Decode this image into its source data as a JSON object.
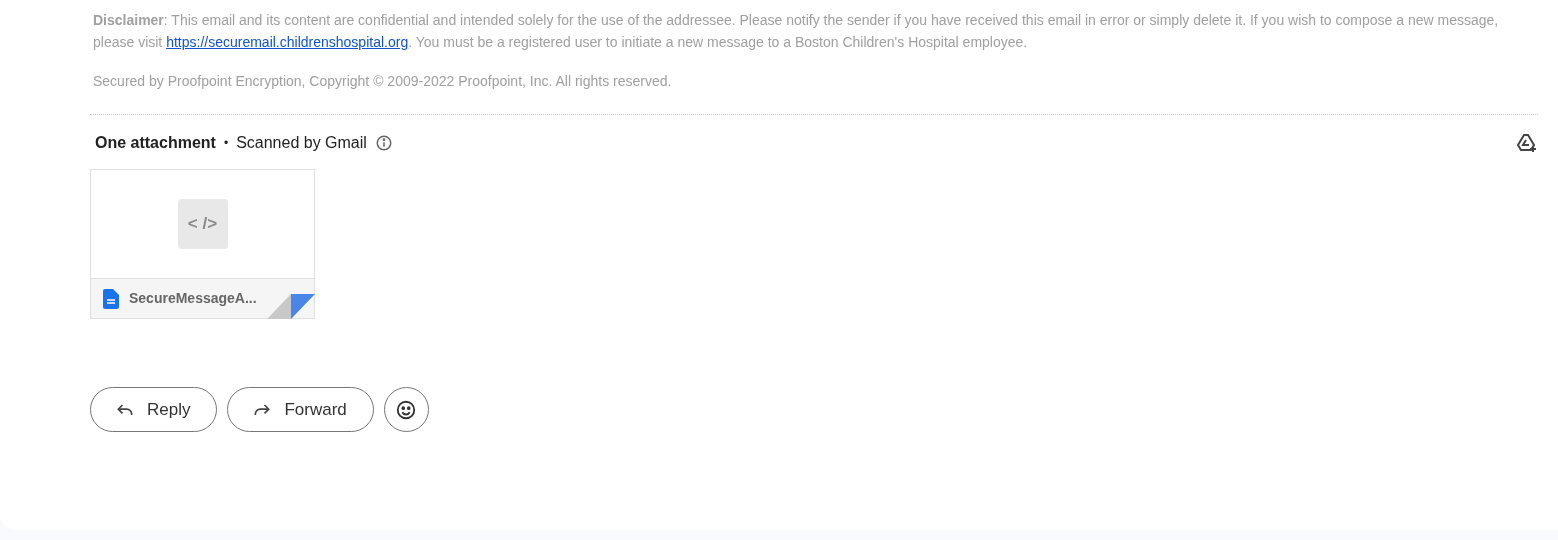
{
  "disclaimer": {
    "before": "**Disclaimer**:  This email and its content are confidential and intended solely for the use of the addressee. Please notify the sender if you have received this email in error or simply delete it. If you wish to compose a new message, please visit ",
    "link": "https://securemail.childrenshospital.org",
    "after": ". You must be a registered user to initiate a new message to a Boston Children's Hospital employee."
  },
  "copyright": "Secured by Proofpoint Encryption, Copyright © 2009-2022 Proofpoint, Inc. All rights reserved.",
  "attachments_header": {
    "title": "One attachment",
    "separator": "•",
    "scan_note": "Scanned by Gmail"
  },
  "attachments": [
    {
      "thumbnail_text": "< />",
      "name": "SecureMessageA..."
    }
  ],
  "actions": [
    {
      "kind": "reply",
      "label": "Reply"
    },
    {
      "kind": "forward",
      "label": "Forward"
    },
    {
      "kind": "emoji"
    }
  ]
}
